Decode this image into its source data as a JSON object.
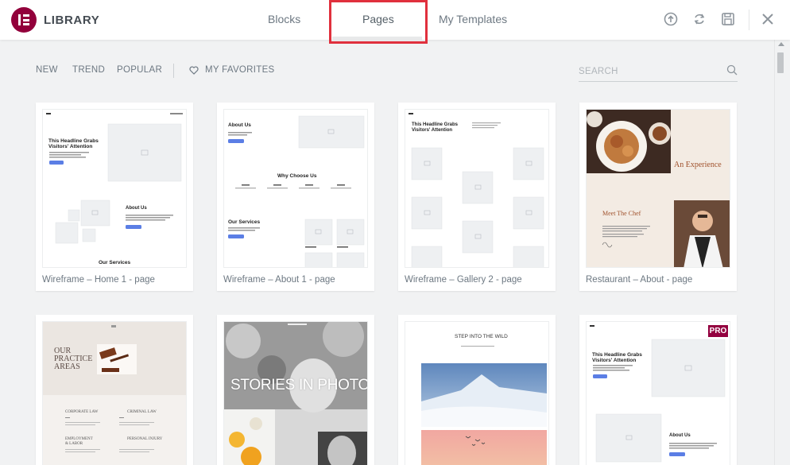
{
  "header": {
    "brand": "LIBRARY",
    "tabs": [
      {
        "label": "Blocks"
      },
      {
        "label": "Pages"
      },
      {
        "label": "My Templates"
      }
    ]
  },
  "filters": {
    "items": [
      "NEW",
      "TREND",
      "POPULAR"
    ],
    "favorites": "MY FAVORITES",
    "search_placeholder": "SEARCH"
  },
  "cards": [
    {
      "title": "Wireframe – Home 1 - page",
      "thumb": {
        "headline": "This Headline Grabs",
        "headline2": "Visitors' Attention",
        "about": "About Us",
        "services": "Our Services"
      }
    },
    {
      "title": "Wireframe – About 1 - page",
      "thumb": {
        "about": "About Us",
        "why": "Why Choose Us",
        "services": "Our Services"
      }
    },
    {
      "title": "Wireframe – Gallery 2 - page",
      "thumb": {
        "headline": "This Headline Grabs",
        "headline2": "Visitors' Attention"
      }
    },
    {
      "title": "Restaurant – About - page",
      "thumb": {
        "experience": "An Experience",
        "chef": "Meet The Chef"
      }
    },
    {
      "title": "",
      "thumb": {
        "l1": "OUR",
        "l2": "PRACTICE",
        "l3": "AREAS",
        "a1": "CORPORATE LAW",
        "a2": "CRIMINAL LAW",
        "a3": "EMPLOYMENT",
        "a3b": "& LABOR",
        "a4": "PERSONAL INJURY"
      }
    },
    {
      "title": "",
      "thumb": {
        "stories": "STORIES IN PHOTOS"
      }
    },
    {
      "title": "",
      "thumb": {
        "wild": "STEP INTO THE WILD"
      }
    },
    {
      "title": "",
      "badge": "PRO",
      "thumb": {
        "headline": "This Headline Grabs",
        "headline2": "Visitors' Attention",
        "about": "About Us"
      }
    }
  ],
  "colors": {
    "brand": "#92003b",
    "highlight": "#e0303d",
    "pro": "#93003f"
  }
}
